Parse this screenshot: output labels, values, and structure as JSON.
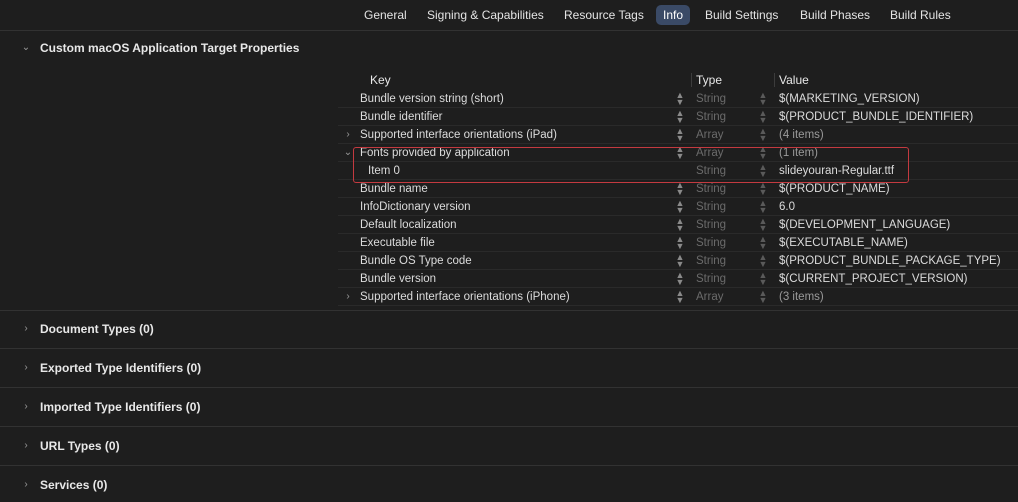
{
  "tabs": [
    {
      "label": "General",
      "active": false
    },
    {
      "label": "Signing & Capabilities",
      "active": false
    },
    {
      "label": "Resource Tags",
      "active": false
    },
    {
      "label": "Info",
      "active": true
    },
    {
      "label": "Build Settings",
      "active": false
    },
    {
      "label": "Build Phases",
      "active": false
    },
    {
      "label": "Build Rules",
      "active": false
    }
  ],
  "sections": {
    "target_properties": "Custom macOS Application Target Properties",
    "document_types": "Document Types (0)",
    "exported_types": "Exported Type Identifiers (0)",
    "imported_types": "Imported Type Identifiers (0)",
    "url_types": "URL Types (0)",
    "services": "Services (0)"
  },
  "table": {
    "headers": {
      "key": "Key",
      "type": "Type",
      "value": "Value"
    },
    "rows": [
      {
        "key": "Bundle version string (short)",
        "type": "String",
        "value": "$(MARKETING_VERSION)",
        "disclosure": ""
      },
      {
        "key": "Bundle identifier",
        "type": "String",
        "value": "$(PRODUCT_BUNDLE_IDENTIFIER)",
        "disclosure": ""
      },
      {
        "key": "Supported interface orientations (iPad)",
        "type": "Array",
        "value": "(4 items)",
        "disclosure": "collapsed"
      },
      {
        "key": "Fonts provided by application",
        "type": "Array",
        "value": "(1 item)",
        "disclosure": "expanded"
      },
      {
        "key": "Item 0",
        "type": "String",
        "value": "slideyouran-Regular.ttf",
        "disclosure": "",
        "child": true
      },
      {
        "key": "Bundle name",
        "type": "String",
        "value": "$(PRODUCT_NAME)",
        "disclosure": ""
      },
      {
        "key": "InfoDictionary version",
        "type": "String",
        "value": "6.0",
        "disclosure": ""
      },
      {
        "key": "Default localization",
        "type": "String",
        "value": "$(DEVELOPMENT_LANGUAGE)",
        "disclosure": ""
      },
      {
        "key": "Executable file",
        "type": "String",
        "value": "$(EXECUTABLE_NAME)",
        "disclosure": ""
      },
      {
        "key": "Bundle OS Type code",
        "type": "String",
        "value": "$(PRODUCT_BUNDLE_PACKAGE_TYPE)",
        "disclosure": ""
      },
      {
        "key": "Bundle version",
        "type": "String",
        "value": "$(CURRENT_PROJECT_VERSION)",
        "disclosure": ""
      },
      {
        "key": "Supported interface orientations (iPhone)",
        "type": "Array",
        "value": "(3 items)",
        "disclosure": "collapsed"
      }
    ]
  },
  "colors": {
    "accent_tab": "#3a4a66",
    "highlight_border": "#c43a40"
  }
}
